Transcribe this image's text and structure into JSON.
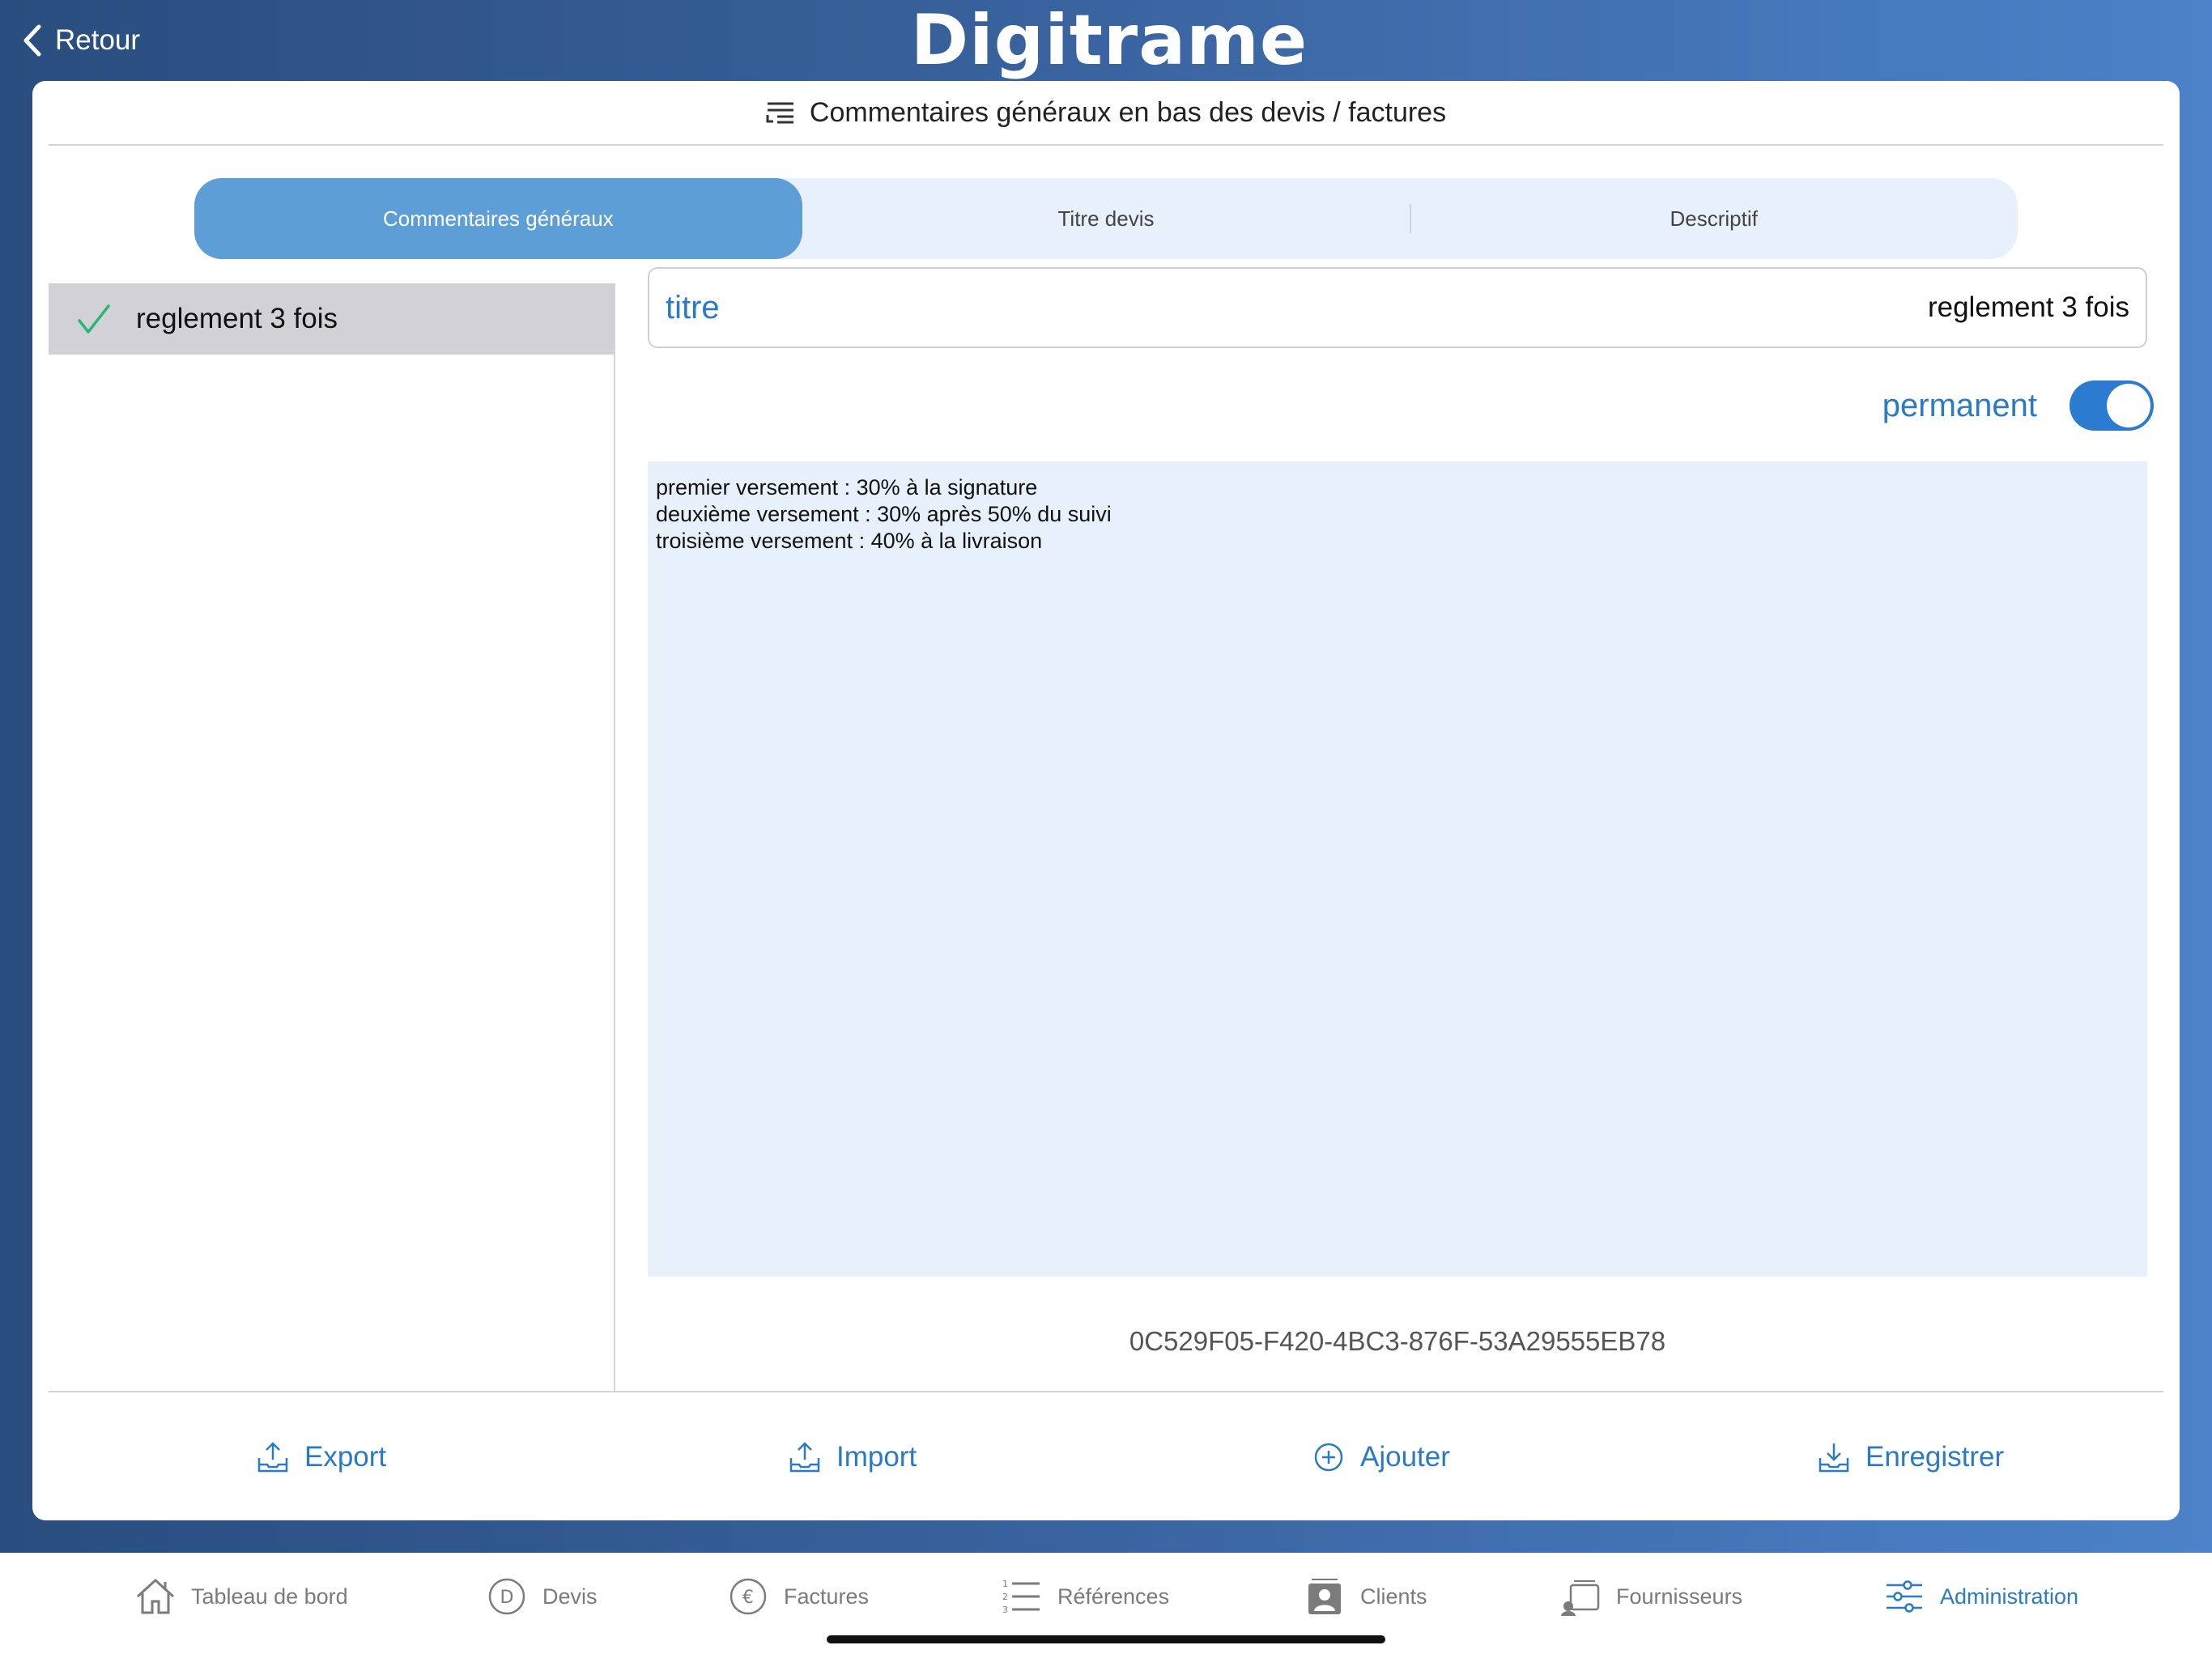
{
  "header": {
    "back_label": "Retour",
    "logo_text": "Digitrame"
  },
  "card": {
    "title": "Commentaires généraux en bas des devis / factures"
  },
  "segments": [
    {
      "label": "Commentaires généraux",
      "active": true
    },
    {
      "label": "Titre devis",
      "active": false
    },
    {
      "label": "Descriptif",
      "active": false
    }
  ],
  "list": {
    "items": [
      {
        "label": "reglement 3 fois",
        "selected": true
      }
    ]
  },
  "form": {
    "title_label": "titre",
    "title_value": "reglement 3 fois",
    "permanent_label": "permanent",
    "permanent_on": true,
    "body_text": "premier versement : 30% à la signature\ndeuxième versement : 30% après 50% du suivi\ntroisième versement : 40% à la livraison",
    "uuid": "0C529F05-F420-4BC3-876F-53A29555EB78"
  },
  "actions": {
    "export": "Export",
    "import": "Import",
    "add": "Ajouter",
    "save": "Enregistrer"
  },
  "tabbar": {
    "items": [
      {
        "label": "Tableau de bord",
        "icon": "home-icon"
      },
      {
        "label": "Devis",
        "icon": "devis-icon"
      },
      {
        "label": "Factures",
        "icon": "euro-icon"
      },
      {
        "label": "Références",
        "icon": "numbered-list-icon"
      },
      {
        "label": "Clients",
        "icon": "contact-icon"
      },
      {
        "label": "Fournisseurs",
        "icon": "supplier-icon"
      },
      {
        "label": "Administration",
        "icon": "sliders-icon",
        "active": true
      }
    ]
  },
  "colors": {
    "accent": "#2a7ac6",
    "segment_active": "#5e9ed7",
    "segment_bg": "#e7f0fb",
    "check": "#2bb673"
  }
}
